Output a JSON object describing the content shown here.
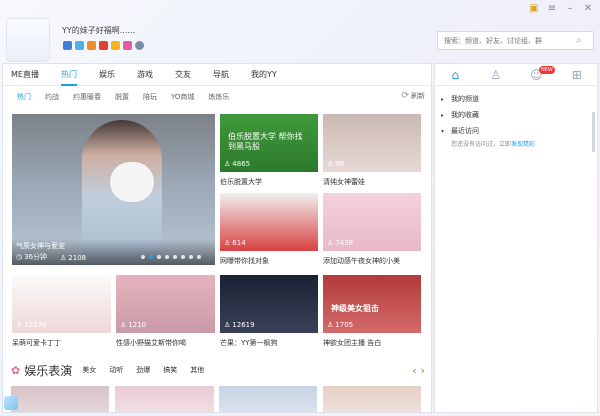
{
  "profile": {
    "signature": "YY的妹子好福啊......"
  },
  "search": {
    "placeholder": "搜索：频道、好友、讨论组、群"
  },
  "main_tabs": [
    "ME直播",
    "热门",
    "娱乐",
    "游戏",
    "交友",
    "导航",
    "我的YY"
  ],
  "sub_tabs": [
    "热门",
    "约战",
    "约惠暖春",
    "脱置",
    "陪玩",
    "YO商城",
    "炼炼乐"
  ],
  "refresh_label": "刷新",
  "featured": {
    "title": "气质女神与爱宠",
    "duration": "36分钟",
    "viewers": "2108"
  },
  "cards": [
    {
      "caption": "伯乐脱置大学",
      "count": "4865",
      "overlay": "伯乐脱置大学 帮你找到黑马股"
    },
    {
      "caption": "清纯女神蕾娃",
      "count": "96"
    },
    {
      "caption": "网曝带你找对象",
      "count": "614"
    },
    {
      "caption": "添加动感午夜女神的小美",
      "count": "7438"
    },
    {
      "caption": "呆萌可爱卡丁丁",
      "count": "12270"
    },
    {
      "caption": "性感小野猫艾斯带你喝",
      "count": "1210"
    },
    {
      "caption": "芒果：YY第一枫狗",
      "count": "12619"
    },
    {
      "caption": "神欲女团主播 告白",
      "count": "1705",
      "overlay": "神级美女狙击"
    }
  ],
  "section": {
    "title": "娱乐表演",
    "categories": [
      "美女",
      "动听",
      "劲爆",
      "搞笑",
      "其他"
    ]
  },
  "side_nodes": [
    {
      "label": "我的频道",
      "open": false
    },
    {
      "label": "我的收藏",
      "open": false
    },
    {
      "label": "最近访问",
      "open": true
    }
  ],
  "side_hint": {
    "text": "您还没有访问过，立即",
    "link": "发现精彩"
  },
  "side_badge": "NEW"
}
